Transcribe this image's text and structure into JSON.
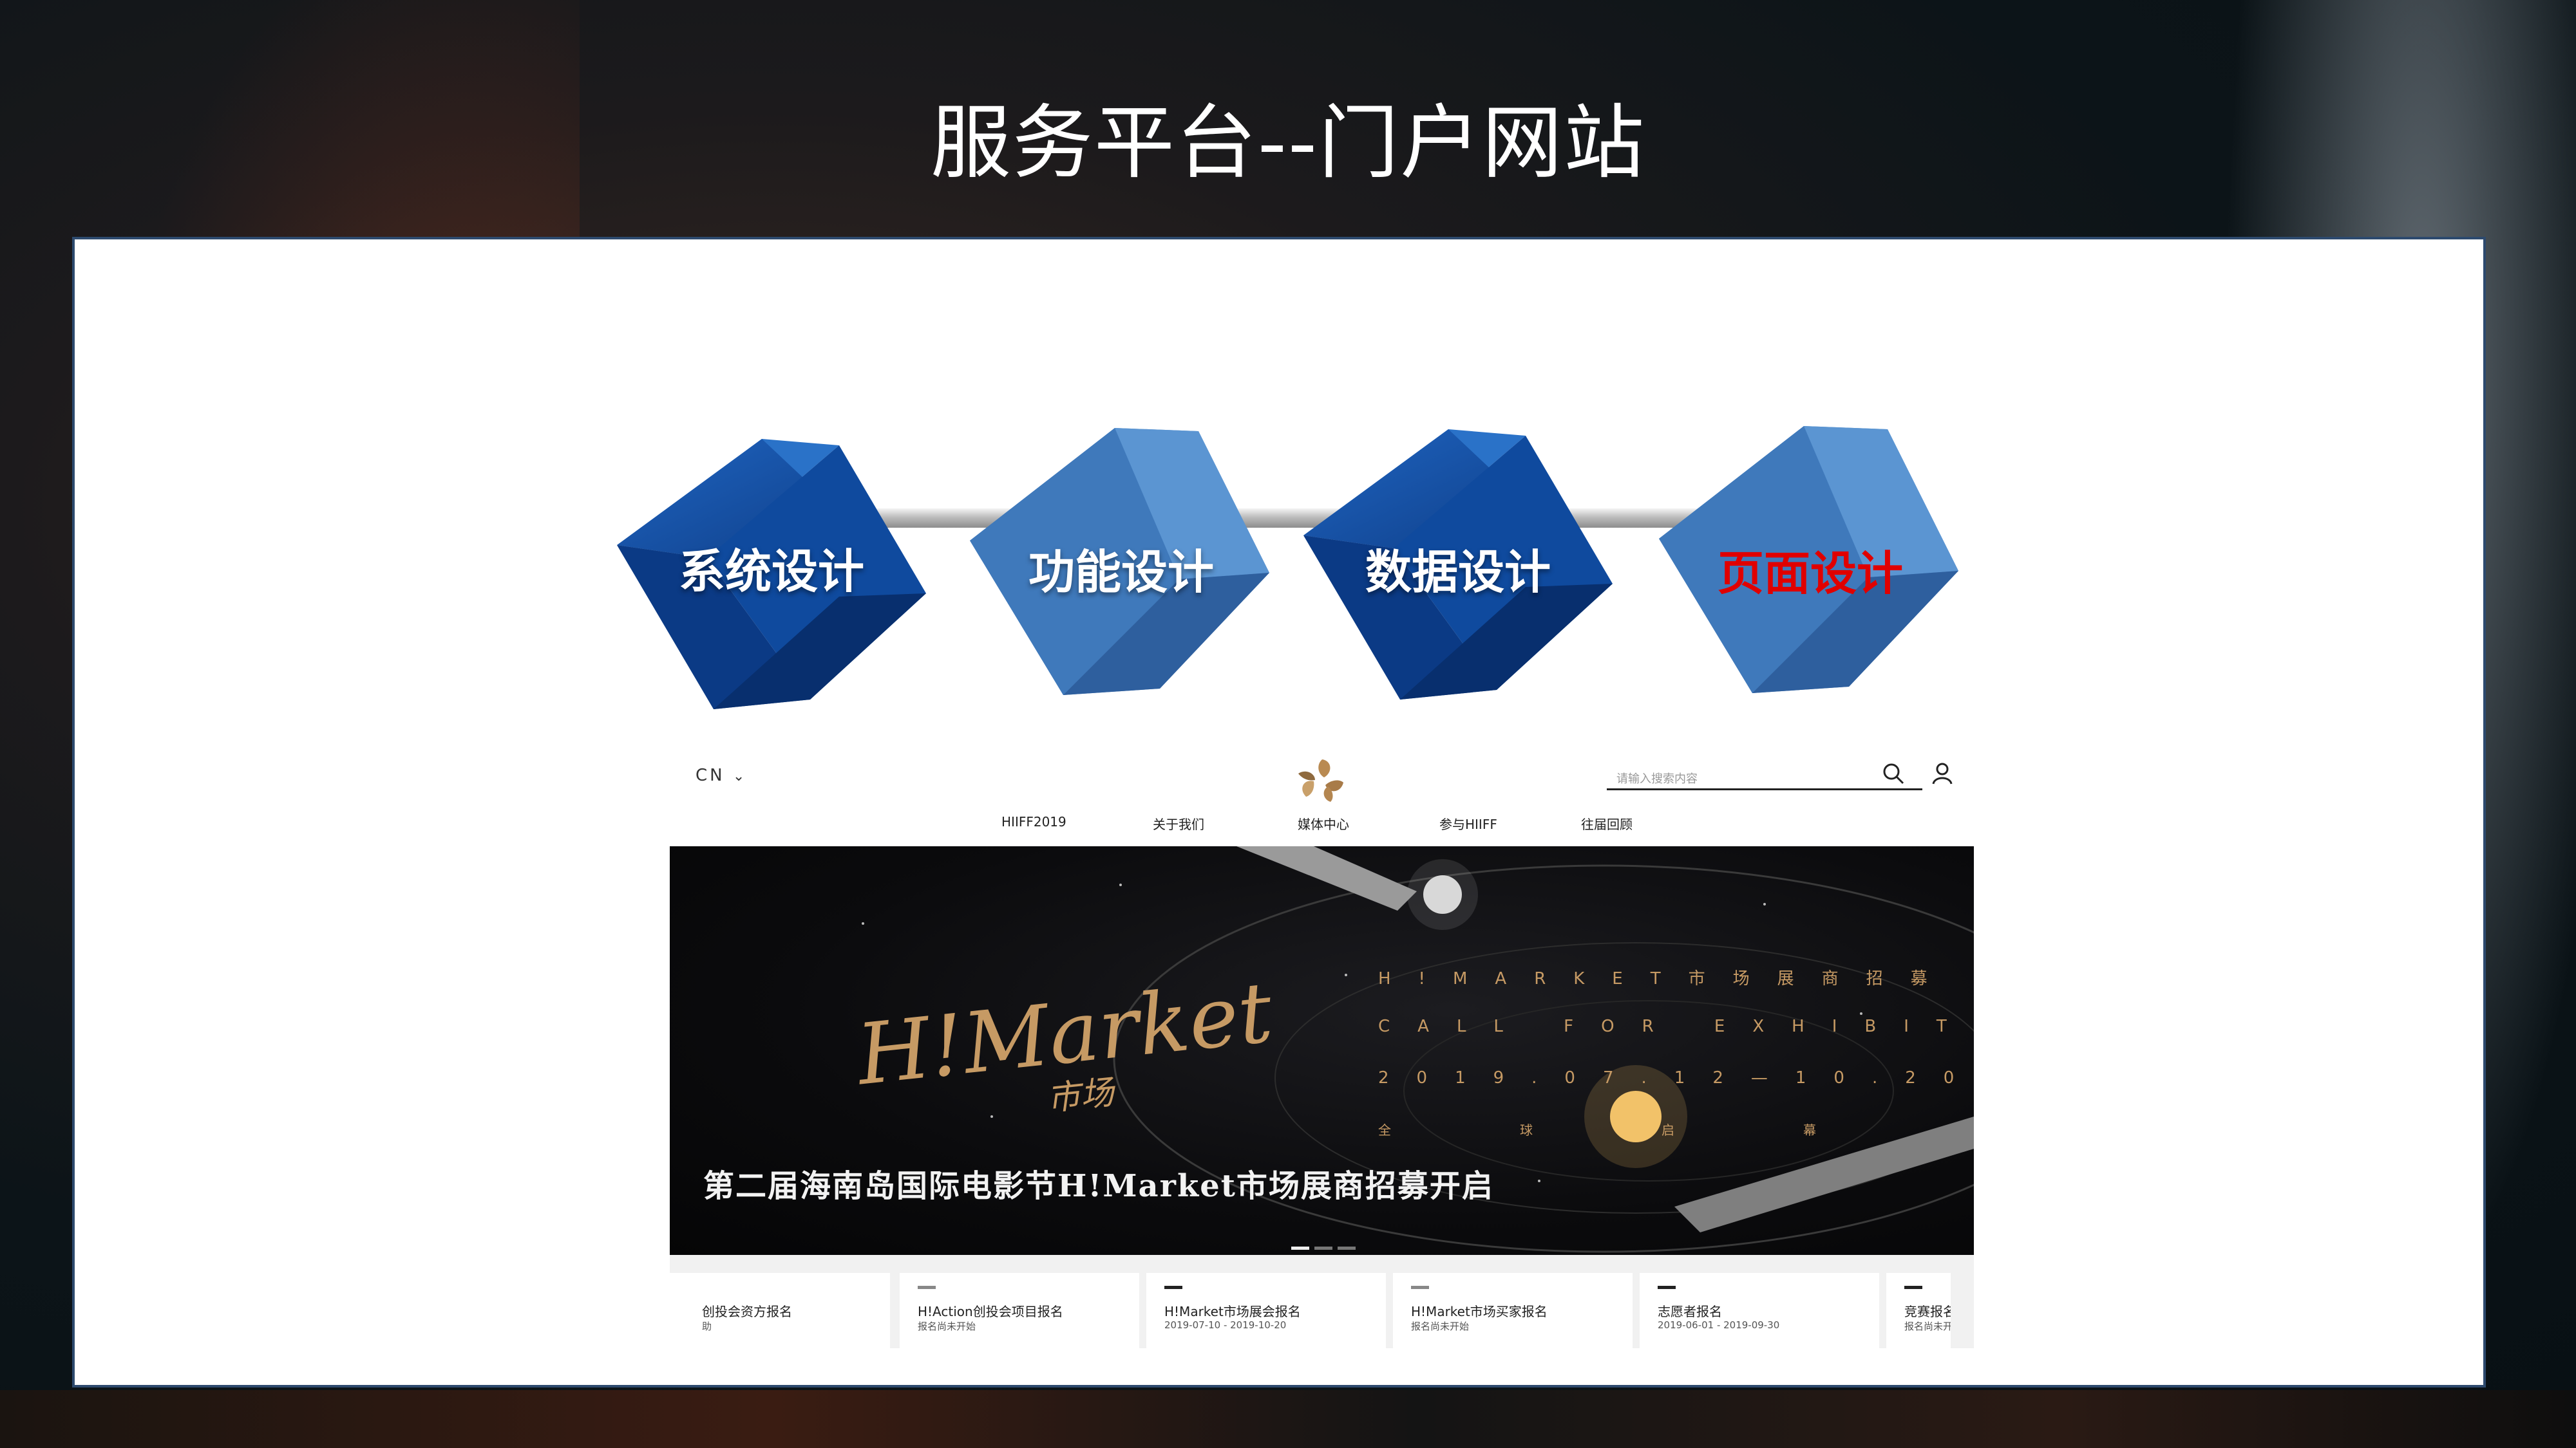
{
  "slide": {
    "title": "服务平台--门户网站"
  },
  "process": {
    "steps": [
      {
        "label": "系统设计",
        "active": false
      },
      {
        "label": "功能设计",
        "active": false
      },
      {
        "label": "数据设计",
        "active": false
      },
      {
        "label": "页面设计",
        "active": true
      }
    ],
    "colors": {
      "cube_dark": "#0c3f8e",
      "cube_light": "#4f86c4",
      "active_text": "#e00000"
    }
  },
  "website": {
    "language_selector": "CN",
    "logo_icon": "hiiff-logo-icon",
    "search": {
      "placeholder": "请输入搜索内容"
    },
    "nav": [
      "HIIFF2019",
      "关于我们",
      "媒体中心",
      "参与HIIFF",
      "往届回顾"
    ],
    "banner": {
      "logo_text": "H!Market",
      "logo_sub": "市场",
      "line1": "H!MARKET市场展商招募",
      "line2": "CALL FOR EXHIBITORS",
      "line3": "2019.07.12—10.20",
      "line4": "全球启幕",
      "caption": "第二届海南岛国际电影节H!Market市场展商招募开启",
      "slide_count": 3,
      "active_slide": 1
    },
    "cards": [
      {
        "title": "创投会资方报名",
        "date": "助"
      },
      {
        "title": "H!Action创投会项目报名",
        "date": "报名尚未开始"
      },
      {
        "title": "H!Market市场展会报名",
        "date": "2019-07-10 - 2019-10-20"
      },
      {
        "title": "H!Market市场买家报名",
        "date": "报名尚未开始"
      },
      {
        "title": "志愿者报名",
        "date": "2019-06-01 - 2019-09-30"
      },
      {
        "title": "竞赛报名",
        "date": "报名尚未开"
      }
    ]
  }
}
